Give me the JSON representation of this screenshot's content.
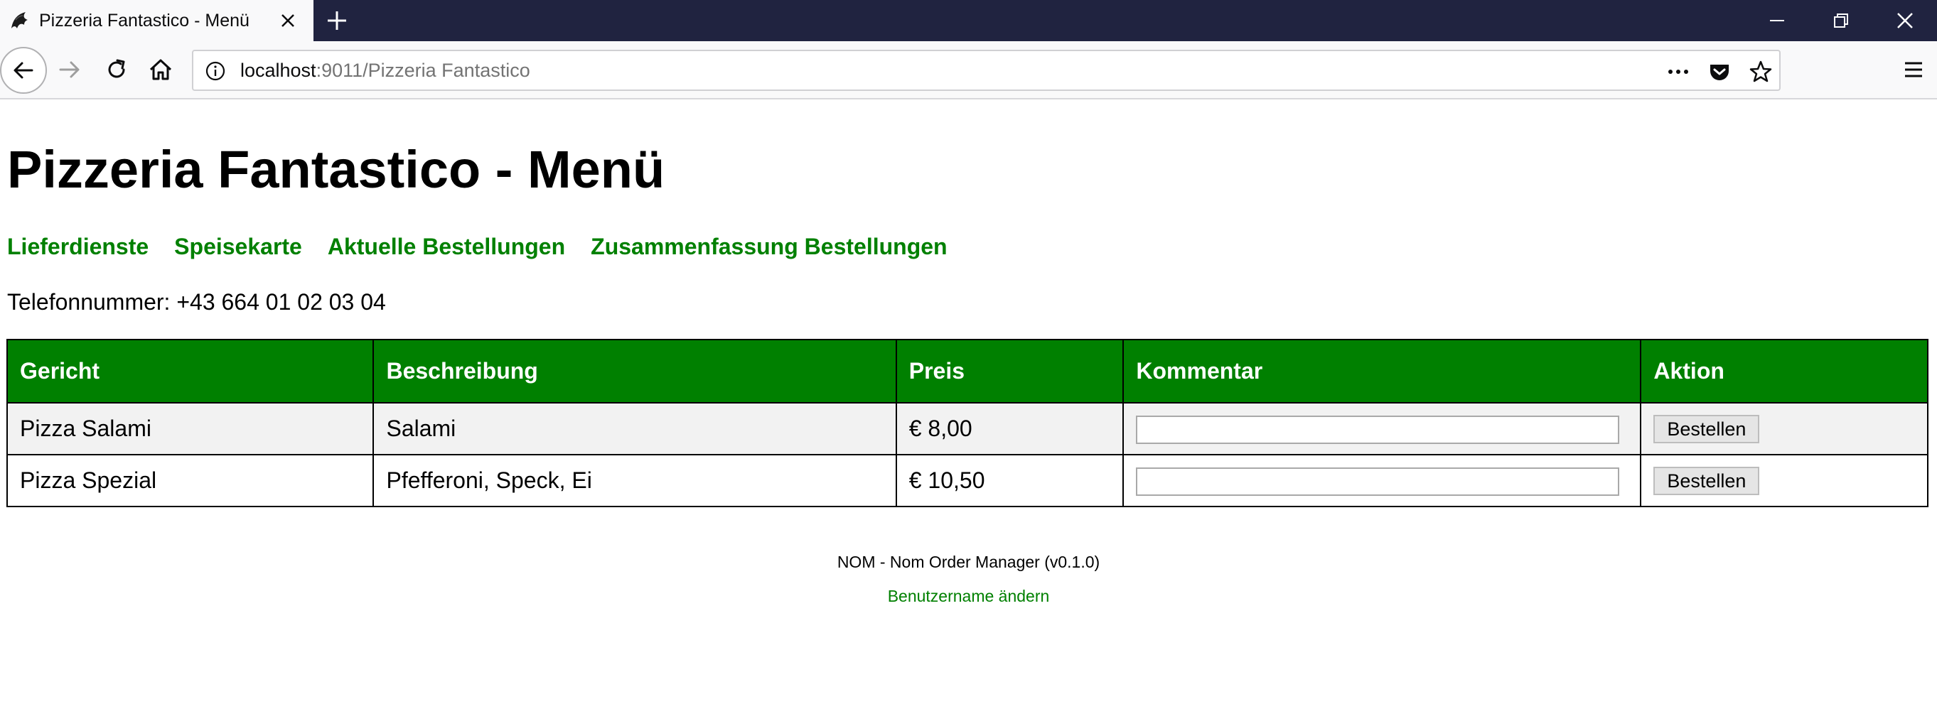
{
  "browser": {
    "tab_title": "Pizzeria Fantastico - Menü",
    "url_host": "localhost",
    "url_rest": ":9011/Pizzeria Fantastico"
  },
  "page": {
    "title": "Pizzeria Fantastico - Menü",
    "nav": [
      {
        "label": "Lieferdienste"
      },
      {
        "label": "Speisekarte"
      },
      {
        "label": "Aktuelle Bestellungen"
      },
      {
        "label": "Zusammenfassung Bestellungen"
      }
    ],
    "phone": "Telefonnummer: +43 664 01 02 03 04",
    "table": {
      "headers": [
        "Gericht",
        "Beschreibung",
        "Preis",
        "Kommentar",
        "Aktion"
      ],
      "rows": [
        {
          "dish": "Pizza Salami",
          "description": "Salami",
          "price": "€ 8,00",
          "comment": "",
          "action": "Bestellen"
        },
        {
          "dish": "Pizza Spezial",
          "description": "Pfefferoni, Speck, Ei",
          "price": "€ 10,50",
          "comment": "",
          "action": "Bestellen"
        }
      ]
    },
    "footer": {
      "text": "NOM - Nom Order Manager (v0.1.0)",
      "link": "Benutzername ändern"
    }
  },
  "colors": {
    "accent": "#008000",
    "titlebar": "#202340"
  },
  "icons": {
    "tab": "firefox-dev-icon",
    "close": "close-icon",
    "new_tab": "plus-icon",
    "back": "back-arrow-icon",
    "forward": "forward-arrow-icon",
    "reload": "reload-icon",
    "home": "home-icon",
    "info": "info-icon",
    "more": "more-icon",
    "pocket": "pocket-icon",
    "bookmark": "star-icon",
    "menu": "hamburger-menu-icon"
  }
}
